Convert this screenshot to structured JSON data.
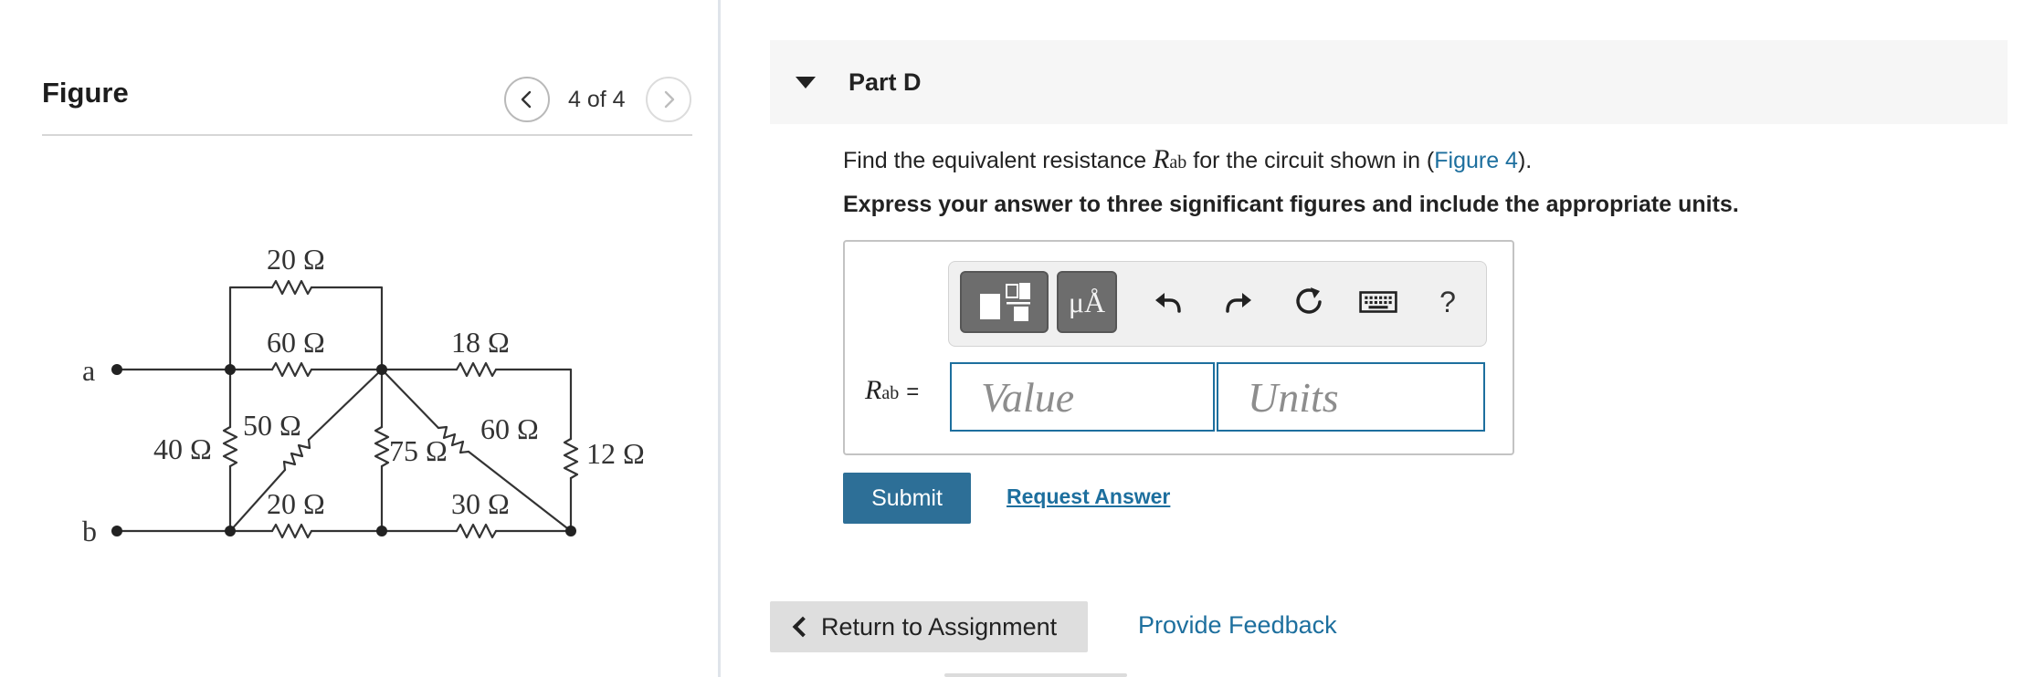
{
  "figure": {
    "title": "Figure",
    "counter": "4 of 4",
    "prev_icon": "chevron-left-icon",
    "next_icon": "chevron-right-icon",
    "circuit": {
      "node_a": "a",
      "node_b": "b",
      "r_20_top": "20 Ω",
      "r_60_top": "60 Ω",
      "r_18": "18 Ω",
      "r_40": "40 Ω",
      "r_50": "50 Ω",
      "r_75": "75 Ω",
      "r_60_diag": "60 Ω",
      "r_12": "12 Ω",
      "r_20_bottom": "20 Ω",
      "r_30": "30 Ω"
    }
  },
  "part": {
    "title": "Part D",
    "caret_icon": "caret-down-icon"
  },
  "question": {
    "prefix": "Find the equivalent resistance ",
    "var": "R",
    "var_sub": "ab",
    "middle": " for the circuit shown in (",
    "link": "Figure 4",
    "suffix": ")."
  },
  "instruction": "Express your answer to three significant figures and include the appropriate units.",
  "toolbar": {
    "templates_icon": "templates-icon",
    "units_label": "μÅ",
    "undo_icon": "undo-icon",
    "redo_icon": "redo-icon",
    "reset_icon": "reset-icon",
    "keyboard_icon": "keyboard-icon",
    "help_label": "?"
  },
  "answer": {
    "label_var": "R",
    "label_sub": "ab",
    "label_eq": "=",
    "value_placeholder": "Value",
    "units_placeholder": "Units"
  },
  "actions": {
    "submit": "Submit",
    "request_answer": "Request Answer",
    "return": "Return to Assignment",
    "feedback": "Provide Feedback"
  },
  "colors": {
    "link": "#1d6f9e",
    "submit_bg": "#2d6f97",
    "header_bg": "#f6f6f6"
  }
}
